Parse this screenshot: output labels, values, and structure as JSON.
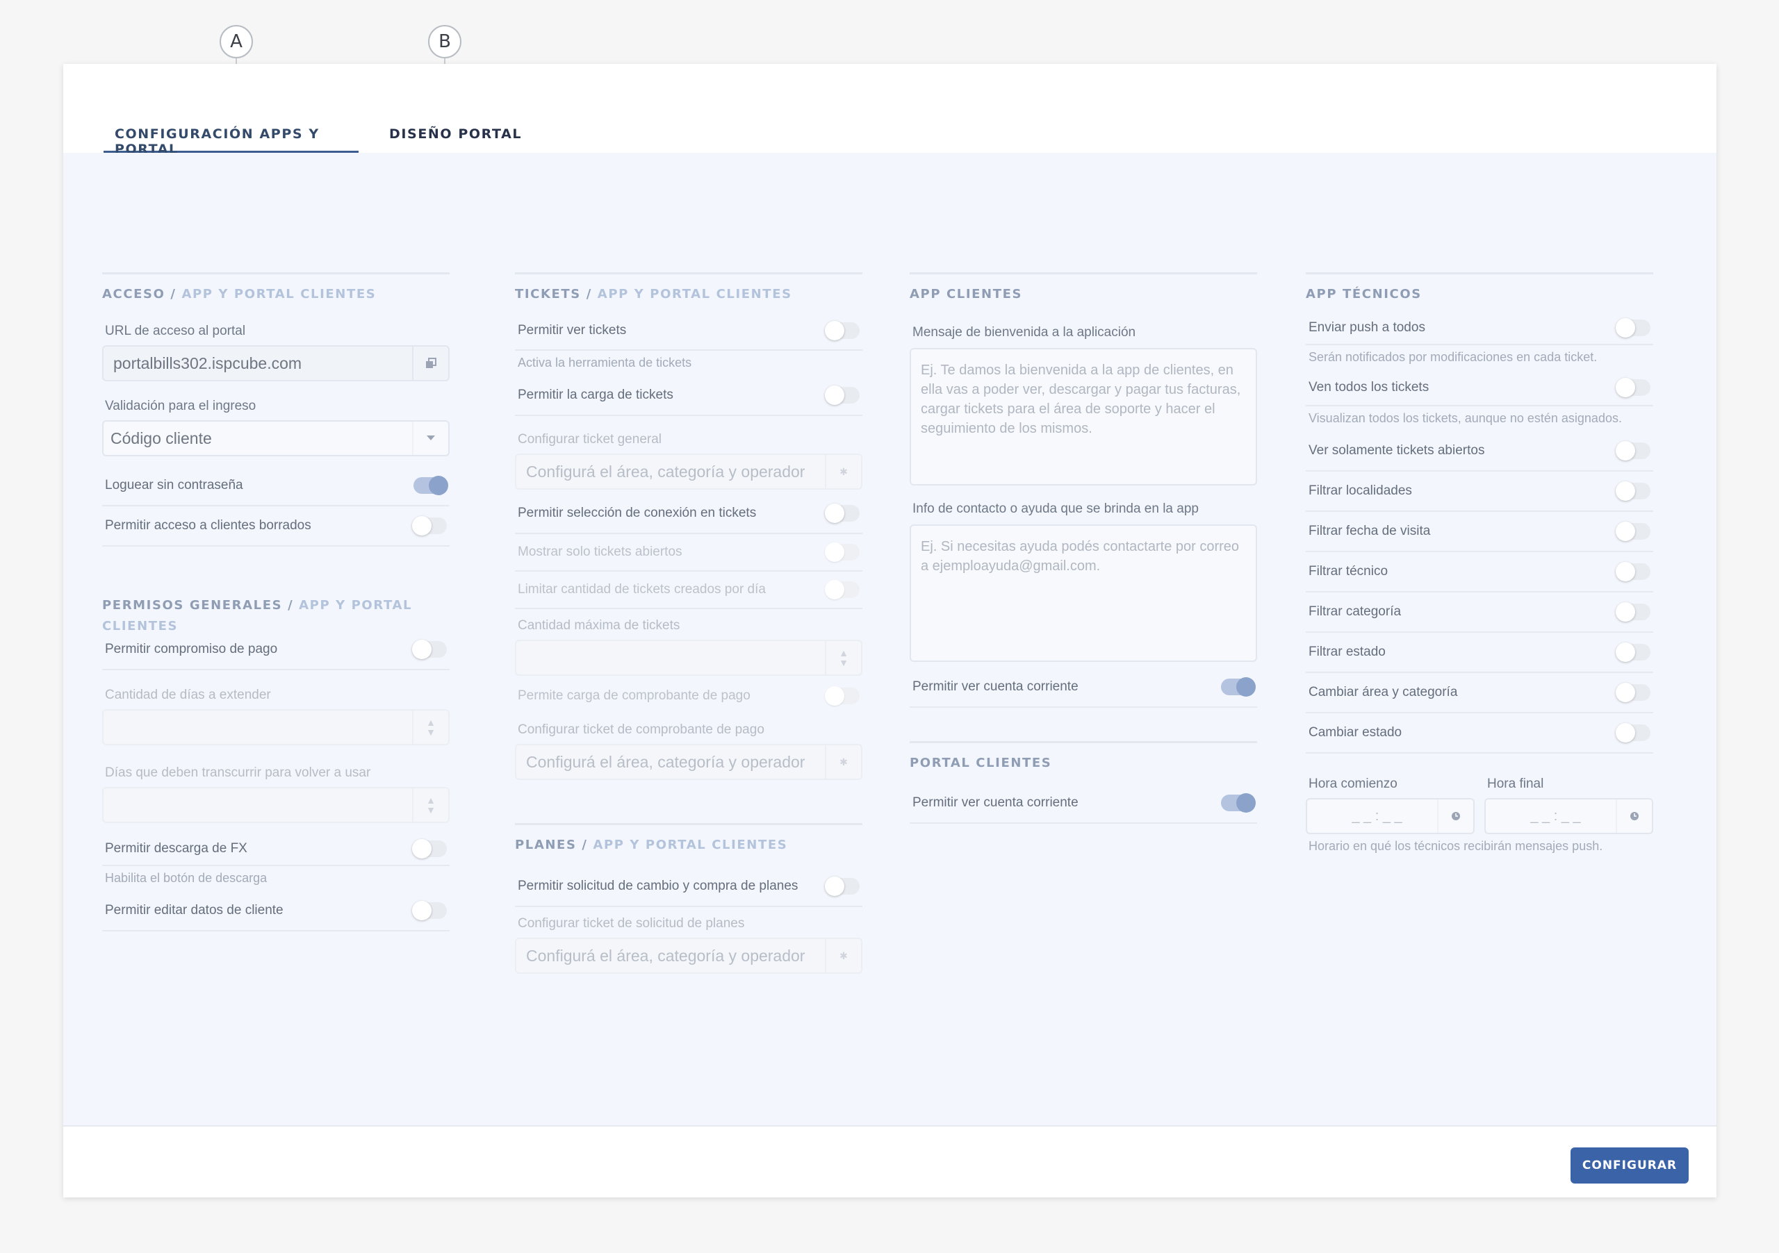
{
  "markers": [
    {
      "letter": "A"
    },
    {
      "letter": "B"
    }
  ],
  "tabs": [
    {
      "label": "CONFIGURACIÓN APPS Y PORTAL",
      "active": true
    },
    {
      "label": "DISEÑO PORTAL",
      "active": false
    }
  ],
  "acceso": {
    "title": "ACCESO",
    "subtitle": "APP Y PORTAL CLIENTES",
    "url_label": "URL de acceso al portal",
    "url_value": "portalbills302.ispcube.com",
    "validacion_label": "Validación para el ingreso",
    "validacion_value": "Código cliente",
    "rows": [
      {
        "label": "Loguear sin contraseña",
        "on": true
      },
      {
        "label": "Permitir acceso a clientes borrados",
        "on": false
      }
    ]
  },
  "permisos": {
    "title": "PERMISOS GENERALES",
    "subtitle": "APP Y PORTAL CLIENTES",
    "compromiso": "Permitir compromiso de pago",
    "dias_extender": "Cantidad de días a extender",
    "dias_volver": "Días que deben transcurrir para volver a usar",
    "descarga_fx": "Permitir descarga de FX",
    "descarga_hint": "Habilita el botón de descarga",
    "editar_datos": "Permitir editar datos de cliente"
  },
  "tickets": {
    "title": "TICKETS",
    "subtitle": "APP Y PORTAL CLIENTES",
    "ver": "Permitir ver tickets",
    "ver_hint": "Activa la herramienta de tickets",
    "carga": "Permitir la carga de tickets",
    "config_general_label": "Configurar ticket general",
    "config_placeholder": "Configurá el área, categoría y operador",
    "seleccion_conexion": "Permitir selección de conexión en tickets",
    "solo_abiertos": "Mostrar solo tickets abiertos",
    "limitar": "Limitar cantidad de tickets creados por día",
    "cantidad_max": "Cantidad máxima de tickets",
    "comprobante": "Permite carga de comprobante de pago",
    "config_comprobante_label": "Configurar ticket de comprobante de pago"
  },
  "planes": {
    "title": "PLANES",
    "subtitle": "APP Y PORTAL CLIENTES",
    "solicitud": "Permitir solicitud de cambio y compra de planes",
    "config_label": "Configurar ticket de solicitud de planes",
    "config_placeholder": "Configurá el área, categoría y operador"
  },
  "app_clientes": {
    "title": "APP CLIENTES",
    "bienvenida_label": "Mensaje de bienvenida a la aplicación",
    "bienvenida_placeholder": "Ej. Te damos la bienvenida a la app de clientes, en ella vas a poder ver, descargar y pagar tus facturas, cargar tickets para el área de soporte y hacer el seguimiento de los mismos.",
    "contacto_label": "Info de contacto o ayuda que se brinda en la app",
    "contacto_placeholder": "Ej. Si necesitas ayuda podés contactarte por correo a ejemploayuda@gmail.com.",
    "cuenta_corriente": "Permitir ver cuenta corriente"
  },
  "portal_clientes": {
    "title": "PORTAL CLIENTES",
    "cuenta_corriente": "Permitir ver cuenta corriente"
  },
  "app_tecnicos": {
    "title": "APP TÉCNICOS",
    "push": "Enviar push a todos",
    "push_hint": "Serán notificados por modificaciones en cada ticket.",
    "ven_todos": "Ven todos los tickets",
    "ven_todos_hint": "Visualizan todos los tickets, aunque no estén asignados.",
    "rows": [
      "Ver solamente tickets abiertos",
      "Filtrar localidades",
      "Filtrar fecha de visita",
      "Filtrar técnico",
      "Filtrar categoría",
      "Filtrar estado",
      "Cambiar área y categoría",
      "Cambiar estado"
    ],
    "hora_comienzo": "Hora comienzo",
    "hora_final": "Hora final",
    "hora_placeholder": "_ _ : _ _",
    "hora_hint": "Horario en qué los técnicos recibirán mensajes push."
  },
  "footer": {
    "configurar": "CONFIGURAR"
  }
}
